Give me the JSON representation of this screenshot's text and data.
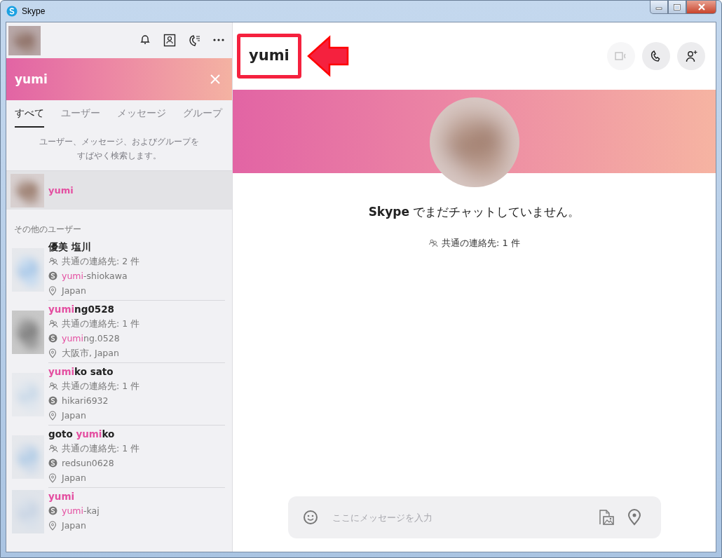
{
  "window": {
    "title": "Skype"
  },
  "search": {
    "value": "yumi"
  },
  "tabs": [
    {
      "label": "すべて",
      "selected": true
    },
    {
      "label": "ユーザー",
      "selected": false
    },
    {
      "label": "メッセージ",
      "selected": false
    },
    {
      "label": "グループ",
      "selected": false
    }
  ],
  "search_hint": [
    "ユーザー、メッセージ、およびグループを",
    "すばやく検索します。"
  ],
  "top_result": {
    "name": "yumi",
    "selected": true
  },
  "section_label": "その他のユーザー",
  "contacts": [
    {
      "name": [
        {
          "text": "優美 塩川",
          "match": false
        }
      ],
      "mutual": "共通の連絡先: 2 件",
      "skype_id": [
        {
          "text": "yumi",
          "match": true
        },
        {
          "text": "-shiokawa",
          "match": false
        }
      ],
      "location": "Japan"
    },
    {
      "name": [
        {
          "text": "yumi",
          "match": true
        },
        {
          "text": "ng0528",
          "match": false
        }
      ],
      "mutual": "共通の連絡先: 1 件",
      "skype_id": [
        {
          "text": "yumi",
          "match": true
        },
        {
          "text": "ng.0528",
          "match": false
        }
      ],
      "location": "大阪市, Japan"
    },
    {
      "name": [
        {
          "text": "yumi",
          "match": true
        },
        {
          "text": "ko sato",
          "match": false
        }
      ],
      "mutual": "共通の連絡先: 1 件",
      "skype_id": [
        {
          "text": "hikari6932",
          "match": false
        }
      ],
      "location": "Japan"
    },
    {
      "name": [
        {
          "text": "goto ",
          "match": false
        },
        {
          "text": "yumi",
          "match": true
        },
        {
          "text": "ko",
          "match": false
        }
      ],
      "mutual": "共通の連絡先: 1 件",
      "skype_id": [
        {
          "text": "redsun0628",
          "match": false
        }
      ],
      "location": "Japan"
    },
    {
      "name": [
        {
          "text": "yumi",
          "match": true
        }
      ],
      "skype_id": [
        {
          "text": "yumi",
          "match": true
        },
        {
          "text": "-kaj",
          "match": false
        }
      ],
      "location": "Japan"
    }
  ],
  "chat": {
    "title": "yumi",
    "highlighted": true,
    "header_buttons": [
      {
        "kind": "video",
        "disabled": true
      },
      {
        "kind": "call",
        "disabled": false
      },
      {
        "kind": "add-person",
        "disabled": false
      }
    ],
    "empty_message": "**Skype** でまだチャットしていません。",
    "mutual": "共通の連絡先: 1 件",
    "composer": {
      "placeholder": "ここにメッセージを入力"
    }
  }
}
